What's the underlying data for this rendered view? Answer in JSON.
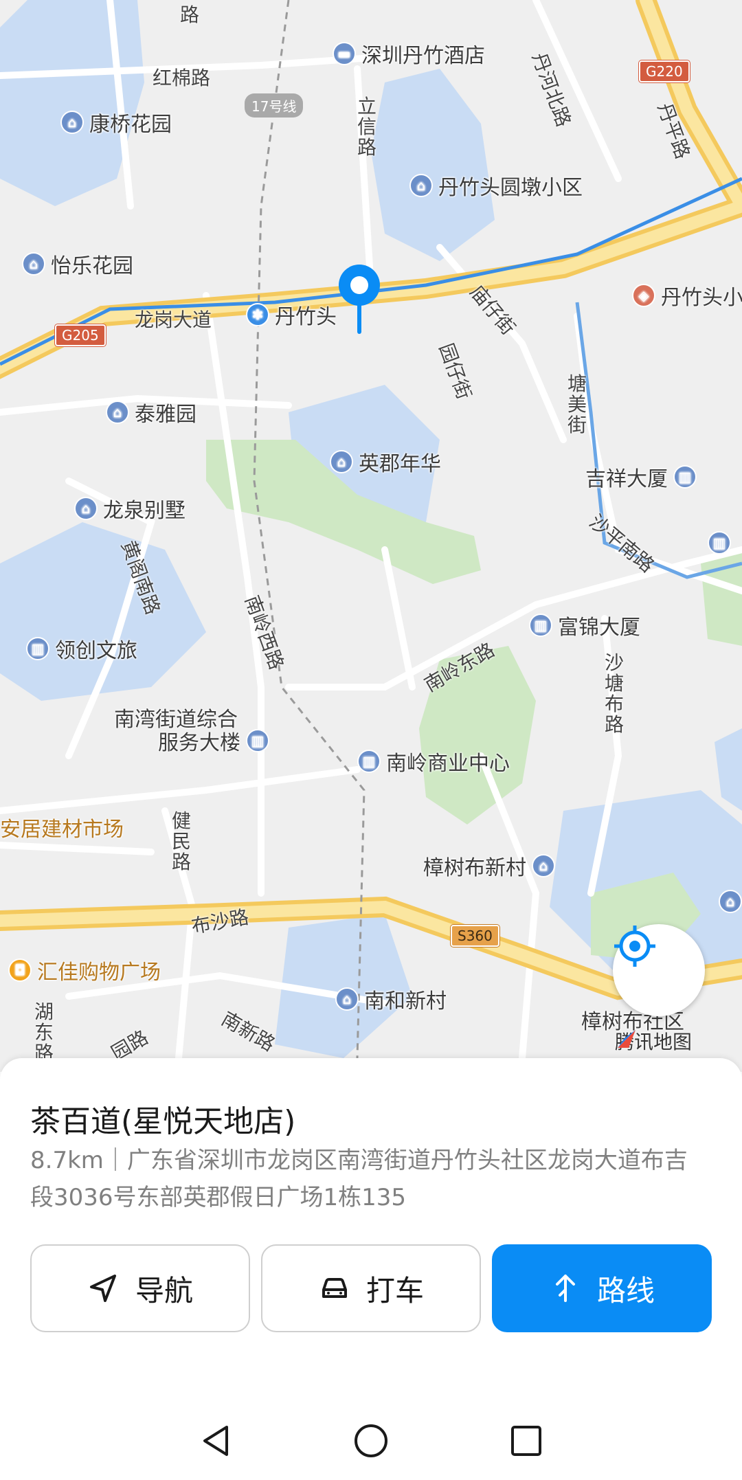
{
  "map": {
    "labels": {
      "danzhu_hotel": "深圳丹竹酒店",
      "hongmian_rd": "红棉路",
      "kangqiao": "康桥花园",
      "line17": "17号线",
      "lixin_rd": "立信路",
      "danhe_north": "丹河北路",
      "danping_rd": "丹平路",
      "yuandun": "丹竹头圆墩小区",
      "yile": "怡乐花园",
      "longgang_ave": "龙岗大道",
      "danzhutou_station": "丹竹头",
      "danzhutou_right": "丹竹头小",
      "miaozai_st": "庙仔街",
      "yuanzai_st": "园仔街",
      "tangmei_st": "塘美街",
      "taiya": "泰雅园",
      "yingjun": "英郡年华",
      "jixiang": "吉祥大厦",
      "longquan": "龙泉别墅",
      "huangge_south": "黄阁南路",
      "shaping_south": "沙平南路",
      "nanling_west": "南岭西路",
      "fujin": "富锦大厦",
      "lingchuang": "领创文旅",
      "nanling_east": "南岭东路",
      "shatangbu": "沙塘布路",
      "nanwan_service_1": "南湾街道综合",
      "nanwan_service_2": "服务大楼",
      "nanling_center": "南岭商业中心",
      "anju": "安居建材市场",
      "jianmin_rd": "健民路",
      "zhangshubu_new": "樟树布新村",
      "busha_rd": "布沙路",
      "huijia": "汇佳购物广场",
      "nanhe": "南和新村",
      "zhangshubu_comm": "樟树布社区",
      "hudong_rd": "湖东路",
      "nanxin_rd": "南新路",
      "yuan_rd": "园路",
      "road_top": "路"
    },
    "shields": {
      "g220": "G220",
      "g205": "G205",
      "s360": "S360"
    },
    "logo": "腾讯地图",
    "colors": {
      "road_major": "#f7d774",
      "road_minor": "#ffffff",
      "water": "#c9dcf4",
      "green": "#cfe8c4",
      "metro": "#3a8ee6",
      "pin": "#0a8cf5"
    }
  },
  "place": {
    "name": "茶百道(星悦天地店)",
    "address": "8.7km｜广东省深圳市龙岗区南湾街道丹竹头社区龙岗大道布吉段3036号东部英郡假日广场1栋135"
  },
  "actions": {
    "navigate": "导航",
    "taxi": "打车",
    "route": "路线"
  },
  "icons": {
    "navigate": "navigation-arrow-icon",
    "taxi": "car-icon",
    "route": "route-arrow-icon",
    "locate": "crosshair-icon"
  }
}
